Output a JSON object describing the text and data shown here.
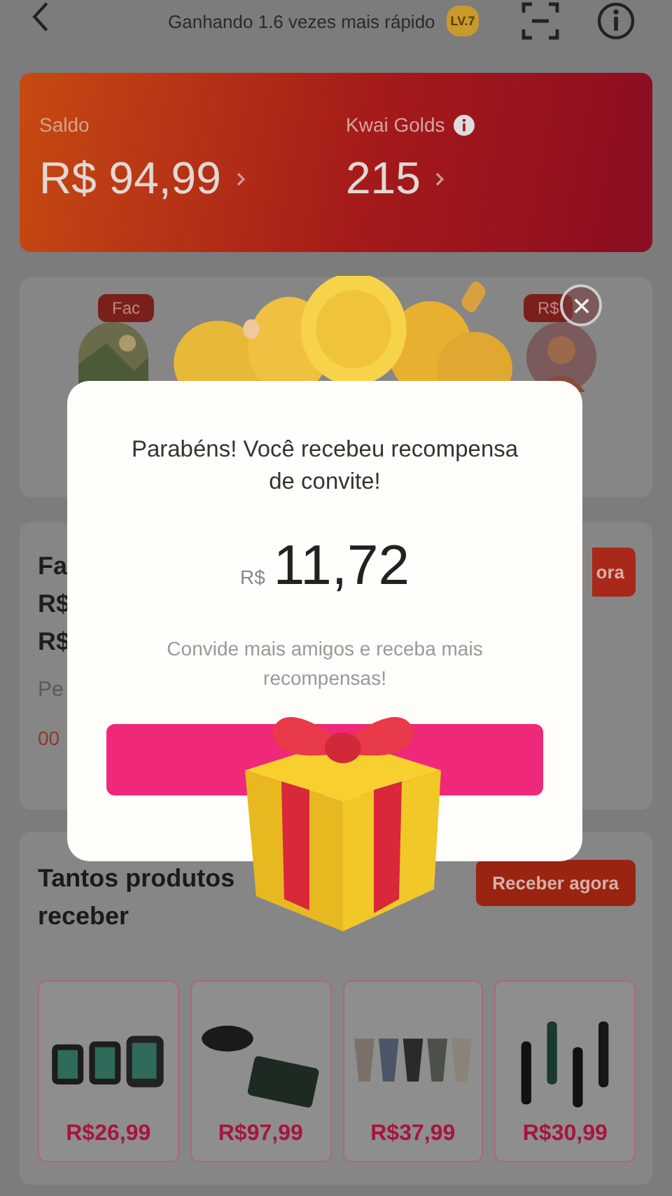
{
  "header": {
    "title": "Ganhando 1.6 vezes mais rápido",
    "level_badge": "LV.7"
  },
  "balance": [
    {
      "label": "Saldo",
      "value": "R$ 94,99",
      "info": false
    },
    {
      "label": "Kwai Golds",
      "value": "215",
      "info": true
    }
  ],
  "reward_card": {
    "tags": [
      "Fac",
      "R$"
    ]
  },
  "task_card": {
    "lines": [
      "Fa",
      "R$",
      "R$"
    ],
    "note": "Pe",
    "timer": "00",
    "button": "ora"
  },
  "products_section": {
    "title_lines": [
      "Tantos produtos",
      "receber"
    ],
    "button": "Receber agora",
    "products": [
      {
        "price": "R$26,99"
      },
      {
        "price": "R$97,99"
      },
      {
        "price": "R$37,99"
      },
      {
        "price": "R$30,99"
      }
    ]
  },
  "dialog": {
    "title": "Parabéns! Você recebeu recompensa de convite!",
    "currency": "R$",
    "amount": "11,72",
    "message": "Convide mais amigos e receba mais recompensas!"
  }
}
